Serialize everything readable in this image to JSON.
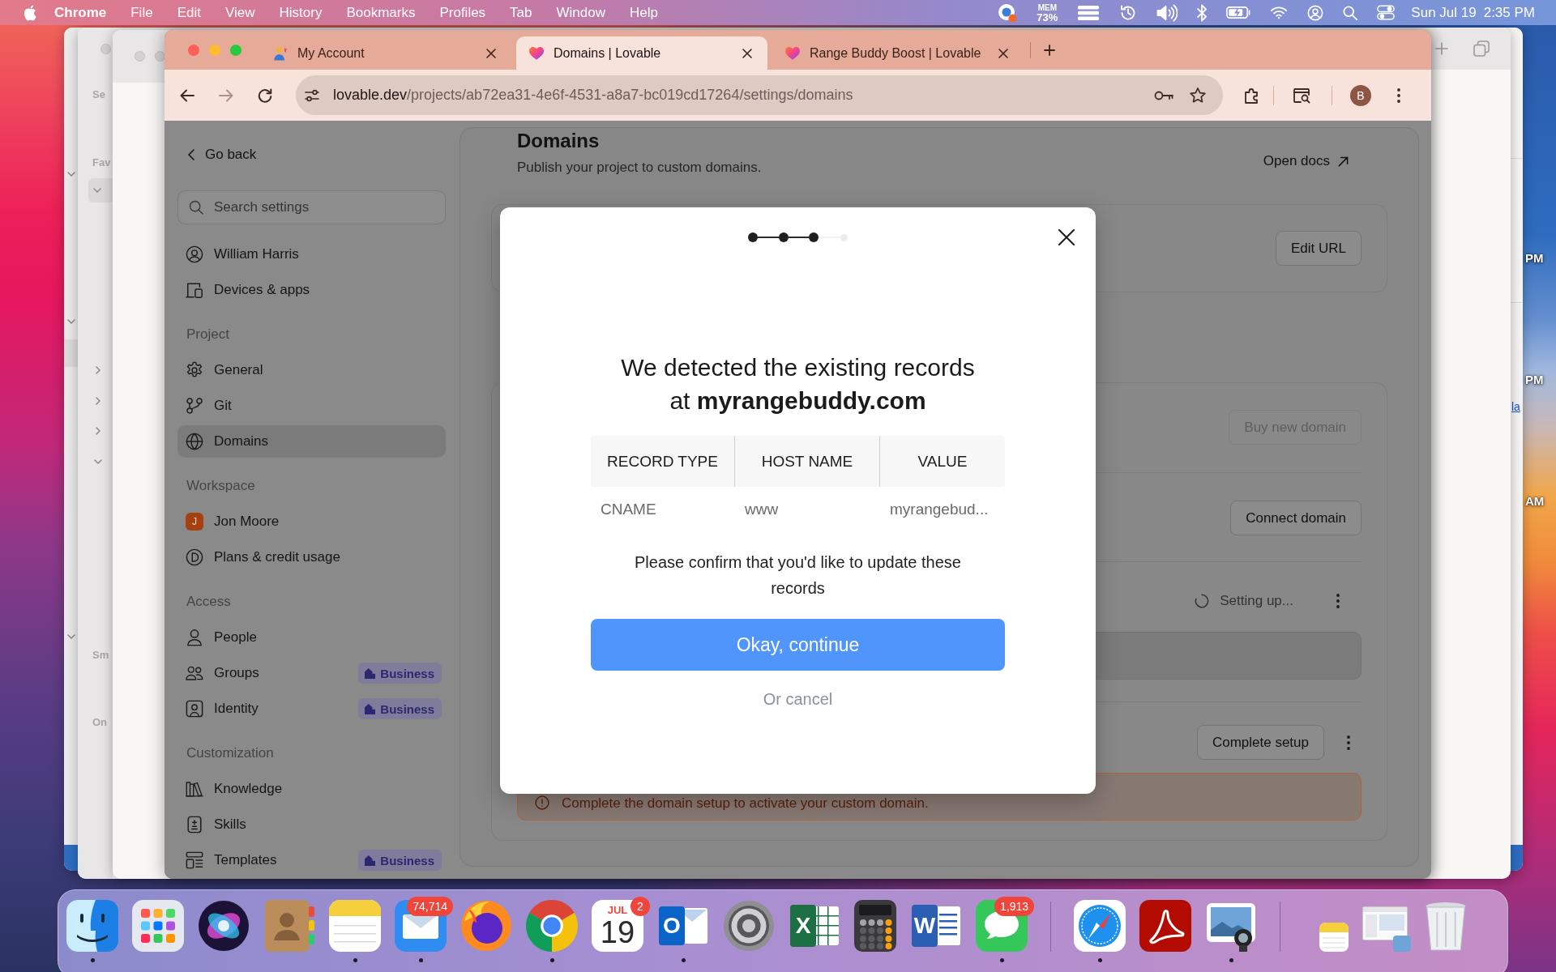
{
  "menu_bar": {
    "app": "Chrome",
    "menus": [
      "File",
      "Edit",
      "View",
      "History",
      "Bookmarks",
      "Profiles",
      "Tab",
      "Window",
      "Help"
    ],
    "memory": {
      "label": "MEM",
      "value": "73%"
    },
    "date": "Sun Jul 19",
    "time": "2:35 PM"
  },
  "background_windows": {
    "sidebar_labels": [
      "Se",
      "Fav",
      "Sm",
      "On"
    ],
    "edge_labels": [
      {
        "text": "PM",
        "kind": "caption"
      },
      {
        "text": "PM",
        "kind": "caption"
      },
      {
        "text": "la",
        "kind": "link"
      },
      {
        "text": "AM",
        "kind": "caption"
      }
    ]
  },
  "browser": {
    "tabs": [
      {
        "title": "My Account",
        "selected": false
      },
      {
        "title": "Domains | Lovable",
        "selected": true
      },
      {
        "title": "Range Buddy Boost | Lovable",
        "selected": false
      }
    ],
    "url": {
      "host": "lovable.dev",
      "path": "/projects/ab72ea31-4e6f-4531-a8a7-bc019cd17264/settings/domains"
    },
    "profile_initial": "B"
  },
  "sidebar": {
    "back": "Go back",
    "search": {
      "placeholder": "Search settings"
    },
    "sections": [
      {
        "items": [
          {
            "label": "William Harris",
            "selected": false
          },
          {
            "label": "Devices & apps",
            "selected": false
          }
        ]
      },
      {
        "heading": "Project",
        "items": [
          {
            "label": "General",
            "selected": false
          },
          {
            "label": "Git",
            "selected": false
          },
          {
            "label": "Domains",
            "selected": true
          }
        ]
      },
      {
        "heading": "Workspace",
        "items": [
          {
            "label": "Jon Moore",
            "initial": "J",
            "selected": false
          },
          {
            "label": "Plans & credit usage",
            "selected": false
          }
        ]
      },
      {
        "heading": "Access",
        "items": [
          {
            "label": "People",
            "selected": false
          },
          {
            "label": "Groups",
            "badge": "Business",
            "selected": false
          },
          {
            "label": "Identity",
            "badge": "Business",
            "selected": false
          }
        ]
      },
      {
        "heading": "Customization",
        "items": [
          {
            "label": "Knowledge",
            "selected": false
          },
          {
            "label": "Skills",
            "selected": false
          },
          {
            "label": "Templates",
            "badge": "Business",
            "selected": false
          }
        ]
      }
    ]
  },
  "page": {
    "title": "Domains",
    "subtitle": "Publish your project to custom domains.",
    "docs_link": "Open docs",
    "url_card": {
      "button": "Edit URL"
    },
    "domain_card": {
      "rows": [
        {
          "kind": "action",
          "button": "Buy new domain",
          "disabled": true
        },
        {
          "kind": "action",
          "button": "Connect domain",
          "disabled": false
        },
        {
          "kind": "pending",
          "status": "Setting up..."
        },
        {
          "kind": "setup",
          "button": "Complete setup",
          "alert": "Complete the domain setup to activate your custom domain."
        }
      ]
    }
  },
  "modal": {
    "steps": [
      {
        "done": true
      },
      {
        "done": true
      },
      {
        "done": true
      },
      {
        "done": false
      }
    ],
    "title": "We detected the existing records at **myrangebuddy.com**",
    "table": {
      "columns": [
        "RECORD TYPE",
        "HOST NAME",
        "VALUE"
      ],
      "rows": [
        [
          "CNAME",
          "www",
          "myrangebud..."
        ]
      ]
    },
    "message": "Please confirm that you'd like to update these records",
    "confirm": "Okay, continue",
    "cancel": "Or cancel"
  },
  "dock": {
    "sections": [
      {
        "apps": [
          {
            "running": true
          },
          {
            "running": false
          },
          {
            "running": false
          },
          {
            "running": false
          },
          {
            "running": true
          },
          {
            "running": true,
            "badge": "74,714"
          },
          {
            "running": false
          },
          {
            "running": true
          },
          {
            "running": false,
            "month": "JUL",
            "day": "19",
            "badge": "2"
          },
          {
            "running": true,
            "letter": "O"
          },
          {
            "running": false
          },
          {
            "running": false,
            "letter": "X"
          },
          {
            "running": false
          },
          {
            "running": false,
            "letter": "W"
          },
          {
            "running": true,
            "badge": "1,913"
          }
        ]
      },
      {
        "apps": [
          {
            "running": true
          },
          {
            "running": false
          },
          {
            "running": true
          }
        ]
      },
      {
        "apps": [
          {
            "running": false
          },
          {
            "running": false
          },
          {
            "running": false
          }
        ]
      }
    ]
  }
}
